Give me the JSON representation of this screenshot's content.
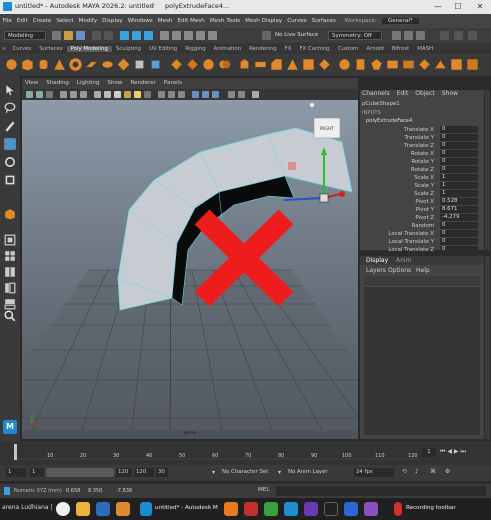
{
  "window": {
    "title": "untitled* - Autodesk MAYA 2026.2: untitled",
    "tab_title": "polyExtrudeFace4...",
    "minimize": "—",
    "maximize": "☐",
    "close": "✕"
  },
  "menus": [
    "File",
    "Edit",
    "Create",
    "Select",
    "Modify",
    "Display",
    "Windows",
    "Mesh",
    "Edit Mesh",
    "Mesh Tools",
    "Mesh Display",
    "Curves",
    "Surfaces"
  ],
  "status": {
    "workspace_label": "Workspace:",
    "workspace_value": "General*",
    "menuset": "Modeling",
    "live_surface": "No Live Surface",
    "symmetry": "Symmetry: Off"
  },
  "shelf_tabs": [
    "Curves",
    "Surfaces",
    "Poly Modeling",
    "Sculpting",
    "UV Editing",
    "Rigging",
    "Animation",
    "Rendering",
    "FX",
    "FX Caching",
    "Custom",
    "Arnold",
    "Bifrost",
    "MASH"
  ],
  "shelf_tabs_active": "Poly Modeling",
  "viewport_menu": [
    "View",
    "Shading",
    "Lighting",
    "Show",
    "Renderer",
    "Panels"
  ],
  "viewport": {
    "camera_label": "persp",
    "viewcube_label": "RIGHT"
  },
  "channel_box": {
    "tabs": [
      "Channels",
      "Edit",
      "Object",
      "Show"
    ],
    "object_name": "pCubeShape1",
    "inputs_label": "INPUTS",
    "node_name": "polyExtrudeFace4",
    "channels": [
      {
        "name": "Translate X",
        "value": "0"
      },
      {
        "name": "Translate Y",
        "value": "0"
      },
      {
        "name": "Translate Z",
        "value": "0"
      },
      {
        "name": "Rotate X",
        "value": "0"
      },
      {
        "name": "Rotate Y",
        "value": "0"
      },
      {
        "name": "Rotate Z",
        "value": "0"
      },
      {
        "name": "Scale X",
        "value": "1"
      },
      {
        "name": "Scale Y",
        "value": "1"
      },
      {
        "name": "Scale Z",
        "value": "1"
      },
      {
        "name": "Pivot X",
        "value": "0.528"
      },
      {
        "name": "Pivot Y",
        "value": "8.671"
      },
      {
        "name": "Pivot Z",
        "value": "-4.279"
      },
      {
        "name": "Random",
        "value": "0"
      },
      {
        "name": "Local Translate X",
        "value": "0"
      },
      {
        "name": "Local Translate Y",
        "value": "0"
      },
      {
        "name": "Local Translate Z",
        "value": "0"
      }
    ]
  },
  "layer_panel": {
    "tabs": [
      "Display",
      "Anim"
    ],
    "menu": [
      "Layers",
      "Options",
      "Help"
    ]
  },
  "timeline": {
    "ticks": [
      "10",
      "20",
      "30",
      "40",
      "50",
      "60",
      "70",
      "80",
      "90",
      "100",
      "110",
      "120"
    ],
    "current_frame": "1"
  },
  "range": {
    "start": "1",
    "start_inner": "1",
    "end_inner": "120",
    "end": "120",
    "end2": "30",
    "character_set": "No Character Set",
    "anim_layer": "No Anim Layer",
    "fps": "24 fps"
  },
  "mel": {
    "label": "MEL",
    "coords_label": "Numeric XYZ (mm)",
    "coord_x": "0.658",
    "coord_y": "8.350",
    "coord_z": "-7.638"
  },
  "taskbar": {
    "left_text": "arena Ludhiana |",
    "maya_task": "untitled* - Autodesk M",
    "recording": "Recording toolbar"
  },
  "colors": {
    "maya_blue": "#3aa0e0",
    "shelf_orange": "#e0892a",
    "red_x": "#ee1c1c"
  }
}
